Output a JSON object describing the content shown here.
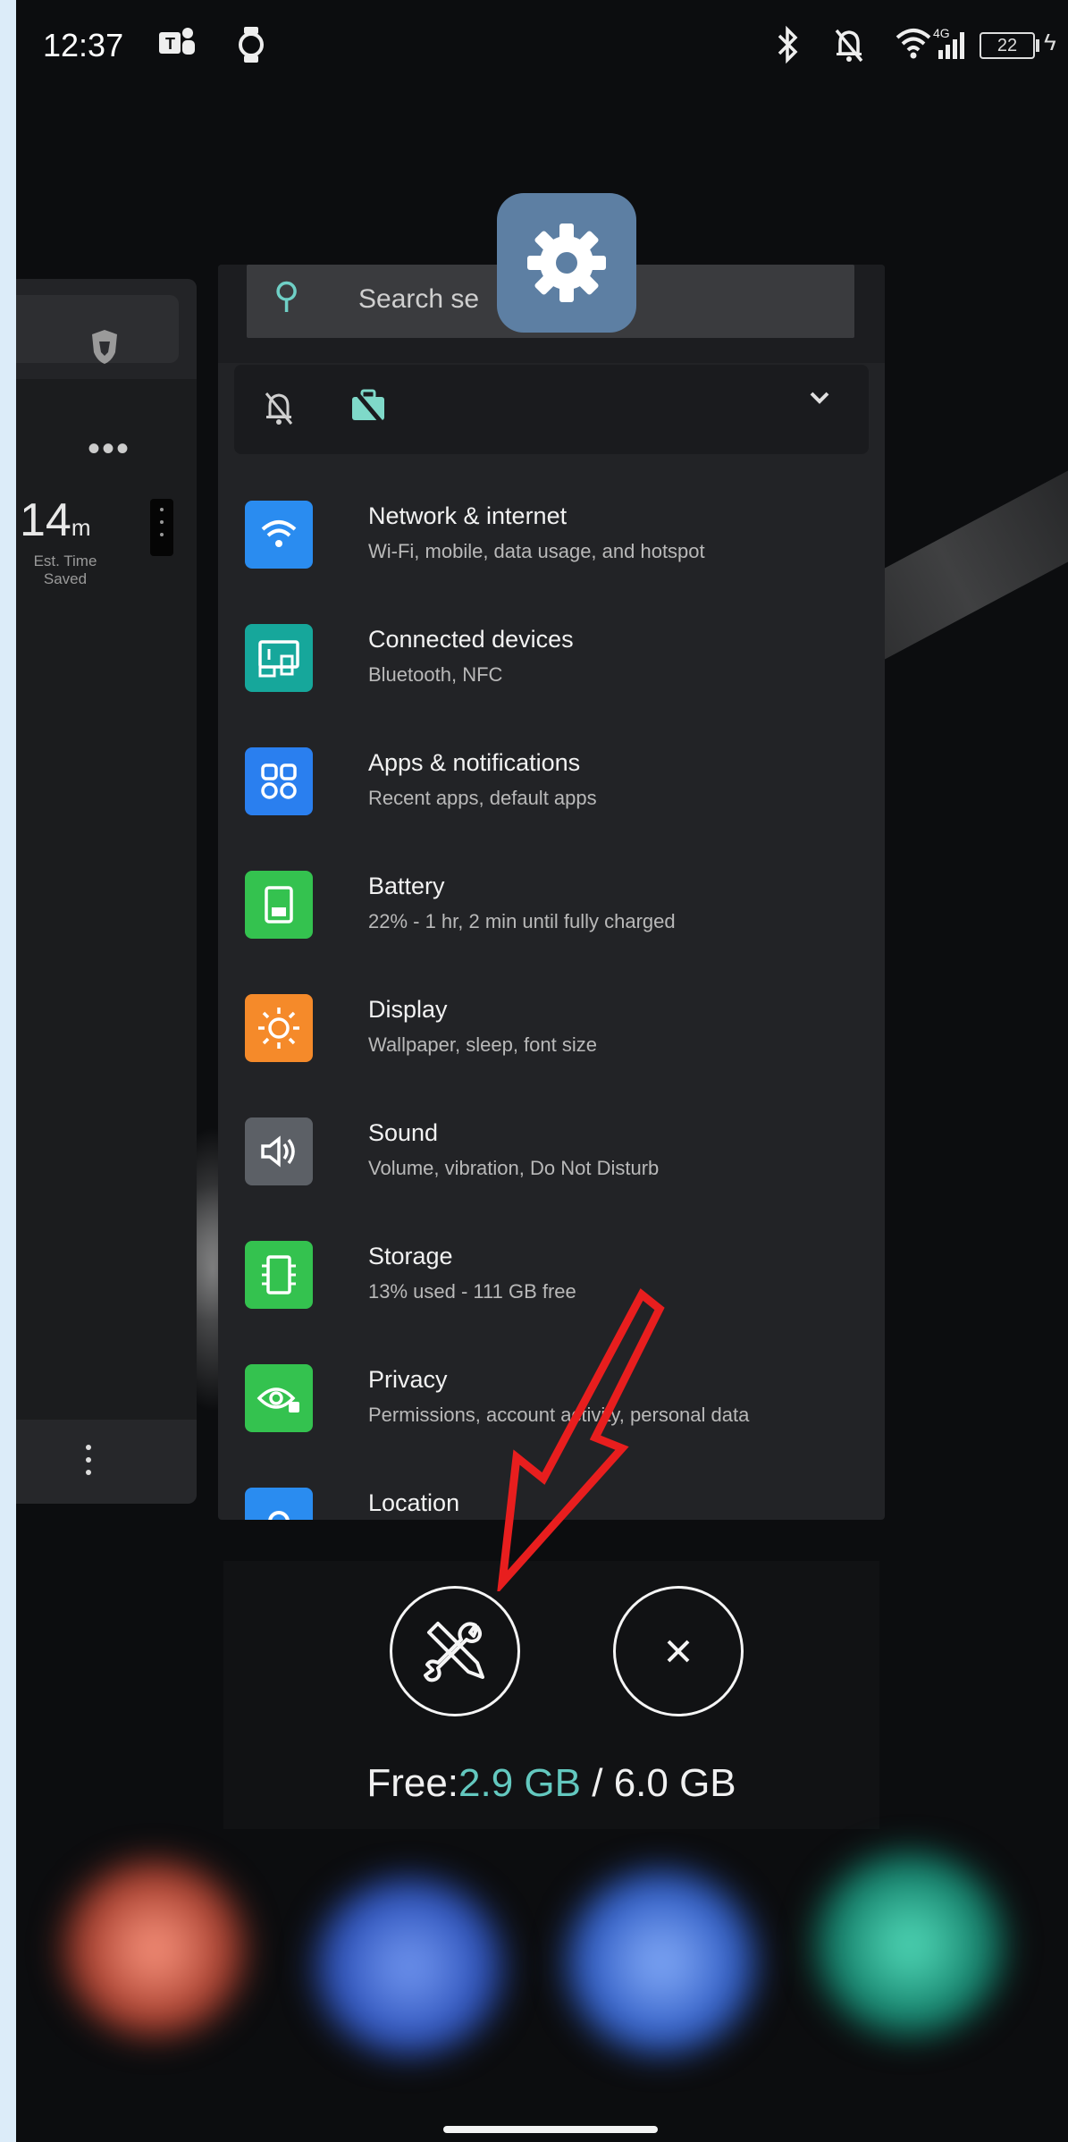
{
  "status_bar": {
    "time": "12:37",
    "battery": "22",
    "network": "4G"
  },
  "left_card": {
    "time_saved_value": "14",
    "time_saved_unit": "m",
    "time_saved_label": "Est. Time Saved"
  },
  "settings": {
    "search_placeholder": "Search settings",
    "search_visible": "Search se",
    "items": [
      {
        "title": "Network & internet",
        "subtitle": "Wi-Fi, mobile, data usage, and hotspot",
        "icon": "wifi-icon",
        "color": "#2a8cf0"
      },
      {
        "title": "Connected devices",
        "subtitle": "Bluetooth, NFC",
        "icon": "devices-icon",
        "color": "#16a79b"
      },
      {
        "title": "Apps & notifications",
        "subtitle": "Recent apps, default apps",
        "icon": "apps-grid-icon",
        "color": "#2a7fef"
      },
      {
        "title": "Battery",
        "subtitle": "22% - 1 hr, 2 min until fully charged",
        "icon": "battery-icon",
        "color": "#34c24f"
      },
      {
        "title": "Display",
        "subtitle": "Wallpaper, sleep, font size",
        "icon": "brightness-icon",
        "color": "#f58a2a"
      },
      {
        "title": "Sound",
        "subtitle": "Volume, vibration, Do Not Disturb",
        "icon": "speaker-icon",
        "color": "#5c6066"
      },
      {
        "title": "Storage",
        "subtitle": "13% used - 111 GB free",
        "icon": "storage-icon",
        "color": "#34c24f"
      },
      {
        "title": "Privacy",
        "subtitle": "Permissions, account activity, personal data",
        "icon": "privacy-eye-icon",
        "color": "#34c24f"
      },
      {
        "title": "Location",
        "subtitle": "",
        "icon": "location-icon",
        "color": "#2a8cf0"
      }
    ]
  },
  "memory": {
    "label": "Free:",
    "free": "2.9 GB",
    "separator": " / ",
    "total": "6.0 GB"
  },
  "colors": {
    "accent": "#63c8bf",
    "annotation_arrow": "#e81e1e",
    "frame": "#dcecf9"
  }
}
